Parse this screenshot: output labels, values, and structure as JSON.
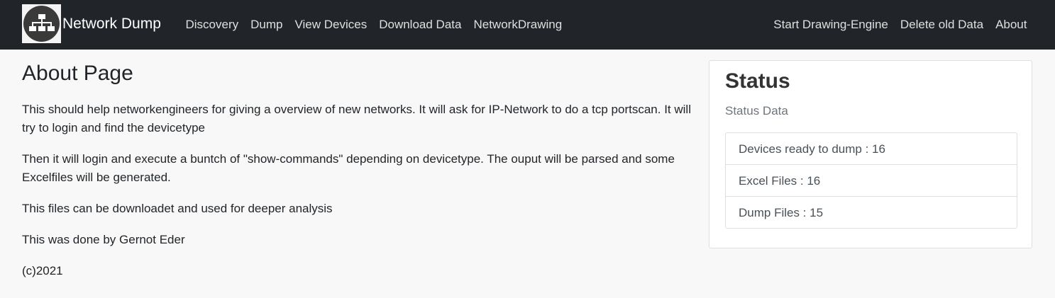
{
  "navbar": {
    "logo_icon": "network-topology-icon",
    "brand": "Network Dump",
    "left_links": [
      "Discovery",
      "Dump",
      "View Devices",
      "Download Data",
      "NetworkDrawing"
    ],
    "right_links": [
      "Start Drawing-Engine",
      "Delete old Data",
      "About"
    ]
  },
  "main": {
    "title": "About Page",
    "paragraphs": [
      "This should help networkengineers for giving a overview of new networks. It will ask for IP-Network to do a tcp portscan. It will try to login and find the devicetype",
      "Then it will login and execute a buntch of \"show-commands\" depending on devicetype. The ouput will be parsed and some Excelfiles will be generated.",
      "This files can be downloadet and used for deeper analysis",
      "This was done by Gernot Eder",
      "(c)2021"
    ]
  },
  "status": {
    "title": "Status",
    "subtitle": "Status Data",
    "items": [
      "Devices ready to dump : 16",
      "Excel Files : 16",
      "Dump Files : 15"
    ]
  }
}
